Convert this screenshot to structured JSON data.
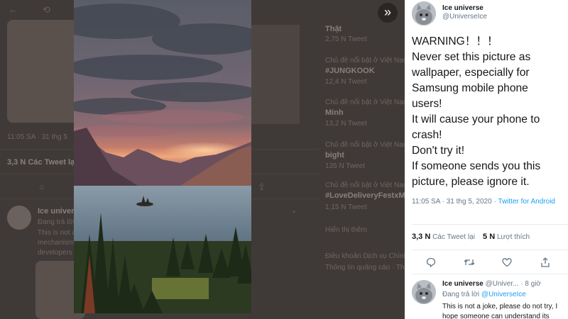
{
  "background": {
    "trends": [
      {
        "meta": "",
        "title": "Thật",
        "count": "2,75 N Tweet"
      },
      {
        "meta": "Chủ đề nổi bật ở Việt Nam",
        "title": "#JUNGKOOK",
        "count": "12,4 N Tweet"
      },
      {
        "meta": "Chủ đề nổi bật ở Việt Nam",
        "title": "Minh",
        "count": "13,2 N Tweet"
      },
      {
        "meta": "Chủ đề nổi bật ở Việt Nam",
        "title": "bight",
        "count": "135 N Tweet"
      },
      {
        "meta": "Chủ đề nổi bật ở Việt Nam",
        "title": "#LoveDeliveryFestxM",
        "count": "1,15 N Tweet"
      },
      {
        "meta": "",
        "title": "Hiển thị thêm",
        "count": ""
      }
    ],
    "bg_time": "11:05 SA · 31 thg 5",
    "bg_stats": "3,3 N  Các Tweet lại",
    "bg_reply_name": "Ice univer...",
    "bg_reply_line1": "Đang trả lời ...",
    "bg_reply_line2": "This is not a joke, ... understand its crash",
    "bg_reply_line3": "mechanism ... please",
    "bg_reply_line4": "developers ...",
    "bg_footer1": "Điều khoản Dịch vụ Chính sách",
    "bg_footer2": "Thông tin quảng cáo · Thêm"
  },
  "viewer": {
    "collapse_icon": "double-chevron-right-icon"
  },
  "tweet": {
    "display_name": "Ice universe",
    "handle": "@UniverseIce",
    "text_lines": [
      "WARNING！！！",
      "Never set this picture as",
      "wallpaper, especially for",
      "Samsung mobile phone",
      "users!",
      "It will cause your phone to",
      "crash!",
      "Don't try it!",
      "If someone sends you this",
      "picture, please ignore it."
    ],
    "timestamp": "11:05 SA · 31 thg 5, 2020 · ",
    "source": "Twitter for Android",
    "retweets_count": "3,3 N",
    "retweets_label": "Các Tweet lại",
    "likes_count": "5 N",
    "likes_label": "Lượt thích"
  },
  "reply": {
    "display_name": "Ice universe",
    "handle_time": "@Univer... · 8 giờ",
    "replying_prefix": "Đang trả lời ",
    "replying_handle": "@UniverseIce",
    "text": "This is not a joke, please do not try, I hope someone can understand its"
  }
}
